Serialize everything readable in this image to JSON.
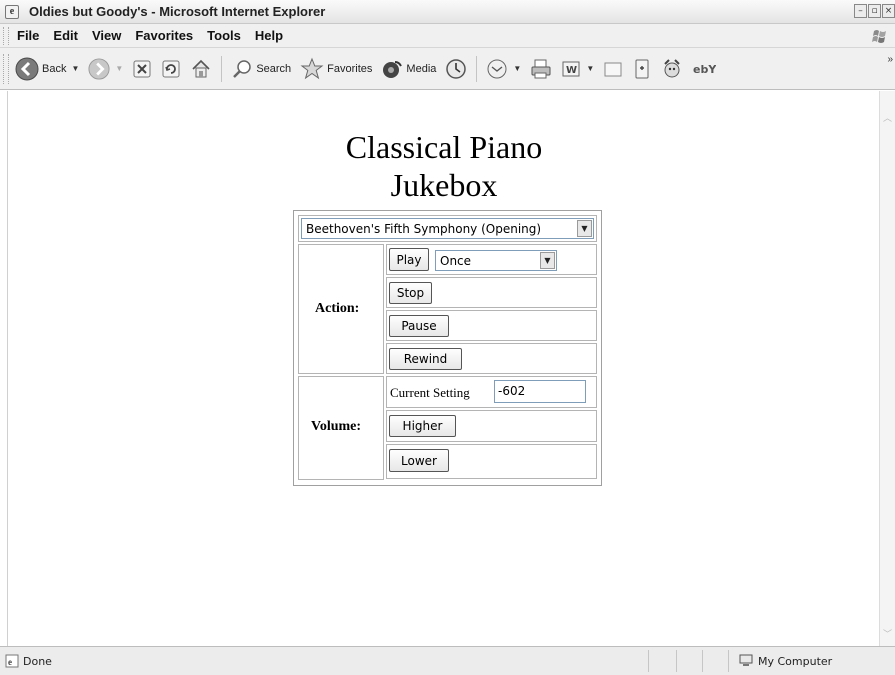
{
  "window": {
    "title": "Oldies but Goody's - Microsoft Internet Explorer",
    "controls": [
      "minimize",
      "restore",
      "close"
    ]
  },
  "menu": [
    "File",
    "Edit",
    "View",
    "Favorites",
    "Tools",
    "Help"
  ],
  "toolbar": {
    "back_label": "Back",
    "search_label": "Search",
    "favorites_label": "Favorites",
    "media_label": "Media",
    "icons": [
      "back-icon",
      "forward-icon",
      "stop-icon",
      "refresh-icon",
      "home-icon",
      "search-icon",
      "favorites-icon",
      "media-icon",
      "history-icon",
      "mail-icon",
      "print-icon",
      "word-icon",
      "discuss-icon",
      "messenger-icon",
      "msn-icon",
      "ebay-icon"
    ]
  },
  "page": {
    "title_line1": "Classical Piano",
    "title_line2": "Jukebox",
    "song_select": {
      "selected": "Beethoven's Fifth Symphony (Opening)"
    },
    "action": {
      "label": "Action:",
      "play_label": "Play",
      "repeat_select": {
        "selected": "Once"
      },
      "stop_label": "Stop",
      "pause_label": "Pause",
      "rewind_label": "Rewind"
    },
    "volume": {
      "label": "Volume:",
      "current_setting_label": "Current Setting",
      "current_value": "-602",
      "higher_label": "Higher",
      "lower_label": "Lower"
    }
  },
  "status": {
    "text": "Done",
    "zone": "My Computer"
  }
}
